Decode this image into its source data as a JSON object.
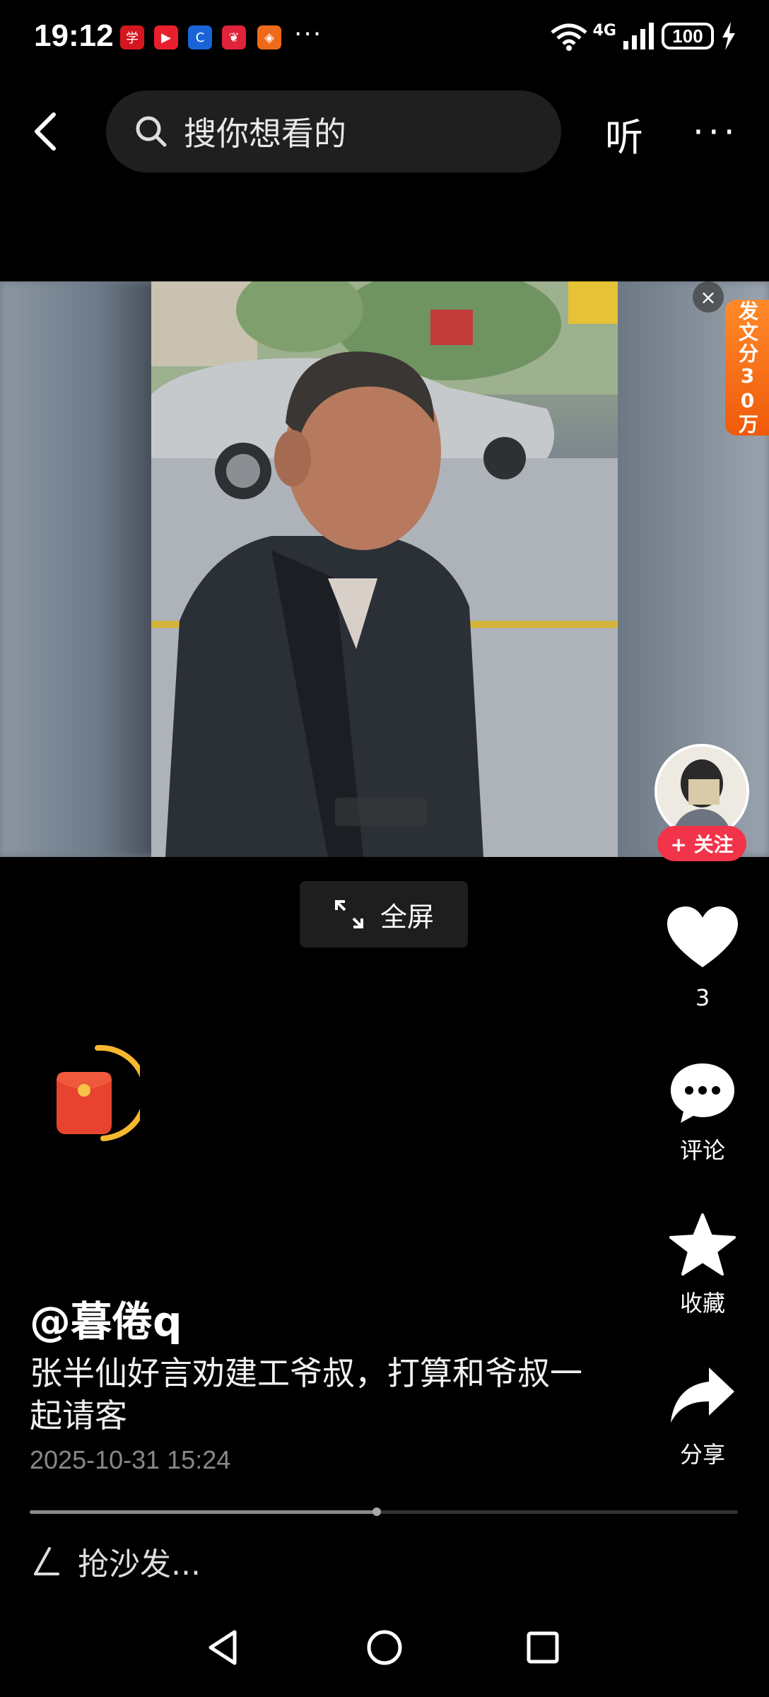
{
  "status_bar": {
    "time": "19:12",
    "app_icons": [
      {
        "name": "app-icon-1",
        "color": "#d4161e",
        "glyph": "学"
      },
      {
        "name": "app-icon-2",
        "color": "#e8202d",
        "glyph": "▶"
      },
      {
        "name": "app-icon-3",
        "color": "#1a64d8",
        "glyph": "C"
      },
      {
        "name": "app-icon-4",
        "color": "#e0223a",
        "glyph": "❦"
      },
      {
        "name": "app-icon-5",
        "color": "#ee6a1a",
        "glyph": "◈"
      }
    ],
    "overflow": "···",
    "network": "4G",
    "battery": "100"
  },
  "top_nav": {
    "search_placeholder": "搜你想看的",
    "listen_label": "听",
    "more": "···"
  },
  "video": {
    "promo_text": "发文分30万",
    "close": "×",
    "follow_label": "+ 关注",
    "fullscreen_label": "全屏"
  },
  "actions": {
    "like_count": "3",
    "comment_label": "评论",
    "favorite_label": "收藏",
    "share_label": "分享"
  },
  "post": {
    "author": "@暮倦q",
    "caption": "张半仙好言劝建工爷叔，打算和爷叔一起请客",
    "date": "2025-10-31 15:24",
    "progress": 0.49
  },
  "comment_input": {
    "placeholder": "抢沙发..."
  },
  "colors": {
    "background": "#000000",
    "accent_red": "#f2344a",
    "promo_orange": "#f26b1d",
    "ring_yellow": "#f5b82e"
  }
}
